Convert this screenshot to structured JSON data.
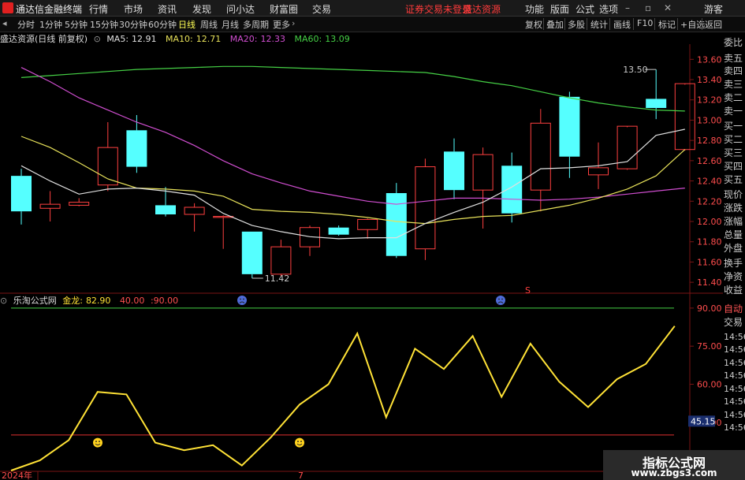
{
  "app": {
    "name": "通达信金融终端",
    "menus": [
      "行情",
      "市场",
      "资讯",
      "发现",
      "问小达",
      "财富圈",
      "交易"
    ],
    "warning": "证券交易未登录",
    "broker": "盛达资源",
    "right_menus": [
      "功能",
      "版面",
      "公式",
      "选项"
    ],
    "guest": "游客"
  },
  "toolbar": {
    "timeframes": [
      "分时",
      "1分钟",
      "5分钟",
      "15分钟",
      "30分钟",
      "60分钟",
      "日线",
      "周线",
      "月线",
      "多周期",
      "更多"
    ],
    "active": "日线",
    "right_tools": [
      "复权",
      "叠加",
      "多股",
      "统计",
      "画线",
      "F10",
      "标记",
      "+自选",
      "返回"
    ]
  },
  "main": {
    "title": "盛达资源(日线 前复权)",
    "ma": [
      {
        "label": "MA5:",
        "value": "12.91",
        "color": "#e0e0e0"
      },
      {
        "label": "MA10:",
        "value": "12.71",
        "color": "#e8e25a"
      },
      {
        "label": "MA20:",
        "value": "12.33",
        "color": "#d04ed0"
      },
      {
        "label": "MA60:",
        "value": "13.09",
        "color": "#45d045"
      }
    ]
  },
  "indicator": {
    "title": "乐淘公式网",
    "label": "金龙:",
    "value": "82.90",
    "lines": [
      "40.00",
      ":90.00"
    ]
  },
  "colors": {
    "up": "#ff4040",
    "down": "#55ffff",
    "ma5": "#e0e0e0",
    "ma10": "#e8e25a",
    "ma20": "#d04ed0",
    "ma60": "#45d045",
    "indicator": "#ffe236"
  },
  "side_labels": [
    "委比",
    "卖五",
    "卖四",
    "卖三",
    "卖二",
    "卖一",
    "买一",
    "买二",
    "买三",
    "买四",
    "买五",
    "现价",
    "涨跌",
    "涨幅",
    "总量",
    "外盘",
    "换手",
    "净资",
    "收益",
    "自动",
    "交易"
  ],
  "side_times": [
    "14:56",
    "14:56",
    "14:56",
    "14:56",
    "14:56",
    "14:56",
    "14:56",
    "14:56"
  ],
  "chart_data": [
    {
      "type": "candlestick",
      "ylim": [
        11.3,
        13.75
      ],
      "yticks": [
        "11.40",
        "11.60",
        "11.80",
        "12.00",
        "12.20",
        "12.40",
        "12.60",
        "12.80",
        "13.00",
        "13.20",
        "13.40",
        "13.60"
      ],
      "annotations": [
        "13.50",
        "11.42"
      ],
      "candles": [
        {
          "o": 12.45,
          "h": 12.52,
          "l": 11.97,
          "c": 12.1
        },
        {
          "o": 12.13,
          "h": 12.3,
          "l": 12.0,
          "c": 12.17
        },
        {
          "o": 12.16,
          "h": 12.23,
          "l": 12.15,
          "c": 12.19
        },
        {
          "o": 12.36,
          "h": 12.98,
          "l": 12.3,
          "c": 12.73
        },
        {
          "o": 12.9,
          "h": 13.05,
          "l": 12.48,
          "c": 12.54
        },
        {
          "o": 12.16,
          "h": 12.34,
          "l": 12.05,
          "c": 12.07
        },
        {
          "o": 12.07,
          "h": 12.18,
          "l": 11.9,
          "c": 12.14
        },
        {
          "o": 12.04,
          "h": 12.06,
          "l": 11.73,
          "c": 12.05
        },
        {
          "o": 11.9,
          "h": 11.9,
          "l": 11.44,
          "c": 11.48
        },
        {
          "o": 11.48,
          "h": 11.82,
          "l": 11.46,
          "c": 11.75
        },
        {
          "o": 11.75,
          "h": 11.96,
          "l": 11.66,
          "c": 11.94
        },
        {
          "o": 11.94,
          "h": 11.96,
          "l": 11.86,
          "c": 11.87
        },
        {
          "o": 11.92,
          "h": 12.03,
          "l": 11.83,
          "c": 12.02
        },
        {
          "o": 12.28,
          "h": 12.38,
          "l": 11.64,
          "c": 11.66
        },
        {
          "o": 11.73,
          "h": 12.62,
          "l": 11.62,
          "c": 12.54
        },
        {
          "o": 12.69,
          "h": 12.82,
          "l": 12.22,
          "c": 12.31
        },
        {
          "o": 12.31,
          "h": 12.73,
          "l": 11.93,
          "c": 12.66
        },
        {
          "o": 12.55,
          "h": 12.68,
          "l": 11.99,
          "c": 12.08
        },
        {
          "o": 12.31,
          "h": 13.11,
          "l": 12.1,
          "c": 12.97
        },
        {
          "o": 13.23,
          "h": 13.28,
          "l": 12.43,
          "c": 12.64
        },
        {
          "o": 12.46,
          "h": 12.78,
          "l": 12.32,
          "c": 12.53
        },
        {
          "o": 12.52,
          "h": 12.93,
          "l": 12.51,
          "c": 12.94
        },
        {
          "o": 13.21,
          "h": 13.5,
          "l": 13.01,
          "c": 13.12
        },
        {
          "o": 12.71,
          "h": 13.35,
          "l": 12.7,
          "c": 13.36
        }
      ],
      "ma5": [
        12.55,
        12.4,
        12.27,
        12.32,
        12.33,
        12.3,
        12.26,
        12.08,
        11.96,
        11.9,
        11.85,
        11.83,
        11.84,
        11.84,
        11.98,
        12.09,
        12.19,
        12.34,
        12.52,
        12.53,
        12.55,
        12.59,
        12.85,
        12.91
      ],
      "ma10": [
        12.84,
        12.73,
        12.58,
        12.42,
        12.33,
        12.32,
        12.3,
        12.25,
        12.12,
        12.1,
        12.09,
        12.07,
        12.04,
        12.0,
        11.98,
        12.02,
        12.05,
        12.06,
        12.11,
        12.16,
        12.23,
        12.32,
        12.45,
        12.71
      ],
      "ma20": [
        13.52,
        13.38,
        13.22,
        13.1,
        12.98,
        12.88,
        12.75,
        12.6,
        12.47,
        12.38,
        12.3,
        12.25,
        12.2,
        12.17,
        12.2,
        12.23,
        12.23,
        12.22,
        12.21,
        12.22,
        12.24,
        12.27,
        12.3,
        12.33
      ],
      "ma60": [
        13.42,
        13.44,
        13.46,
        13.48,
        13.5,
        13.51,
        13.52,
        13.53,
        13.53,
        13.52,
        13.51,
        13.5,
        13.49,
        13.48,
        13.47,
        13.43,
        13.38,
        13.34,
        13.28,
        13.22,
        13.17,
        13.13,
        13.1,
        13.09
      ]
    },
    {
      "type": "line",
      "name": "金龙",
      "ylim": [
        26,
        94
      ],
      "yticks": [
        "30.00",
        "45.00",
        "60.00",
        "75.00",
        "90.00"
      ],
      "hlines": [
        40,
        90
      ],
      "values": [
        26,
        30,
        38,
        57,
        56,
        37,
        34,
        36,
        28,
        39,
        52,
        60,
        80,
        47,
        74,
        66,
        79,
        55,
        76,
        61,
        51,
        62,
        68,
        82.9
      ],
      "current_label": "45.15",
      "xlabels": [
        "2024年",
        "7"
      ]
    }
  ]
}
